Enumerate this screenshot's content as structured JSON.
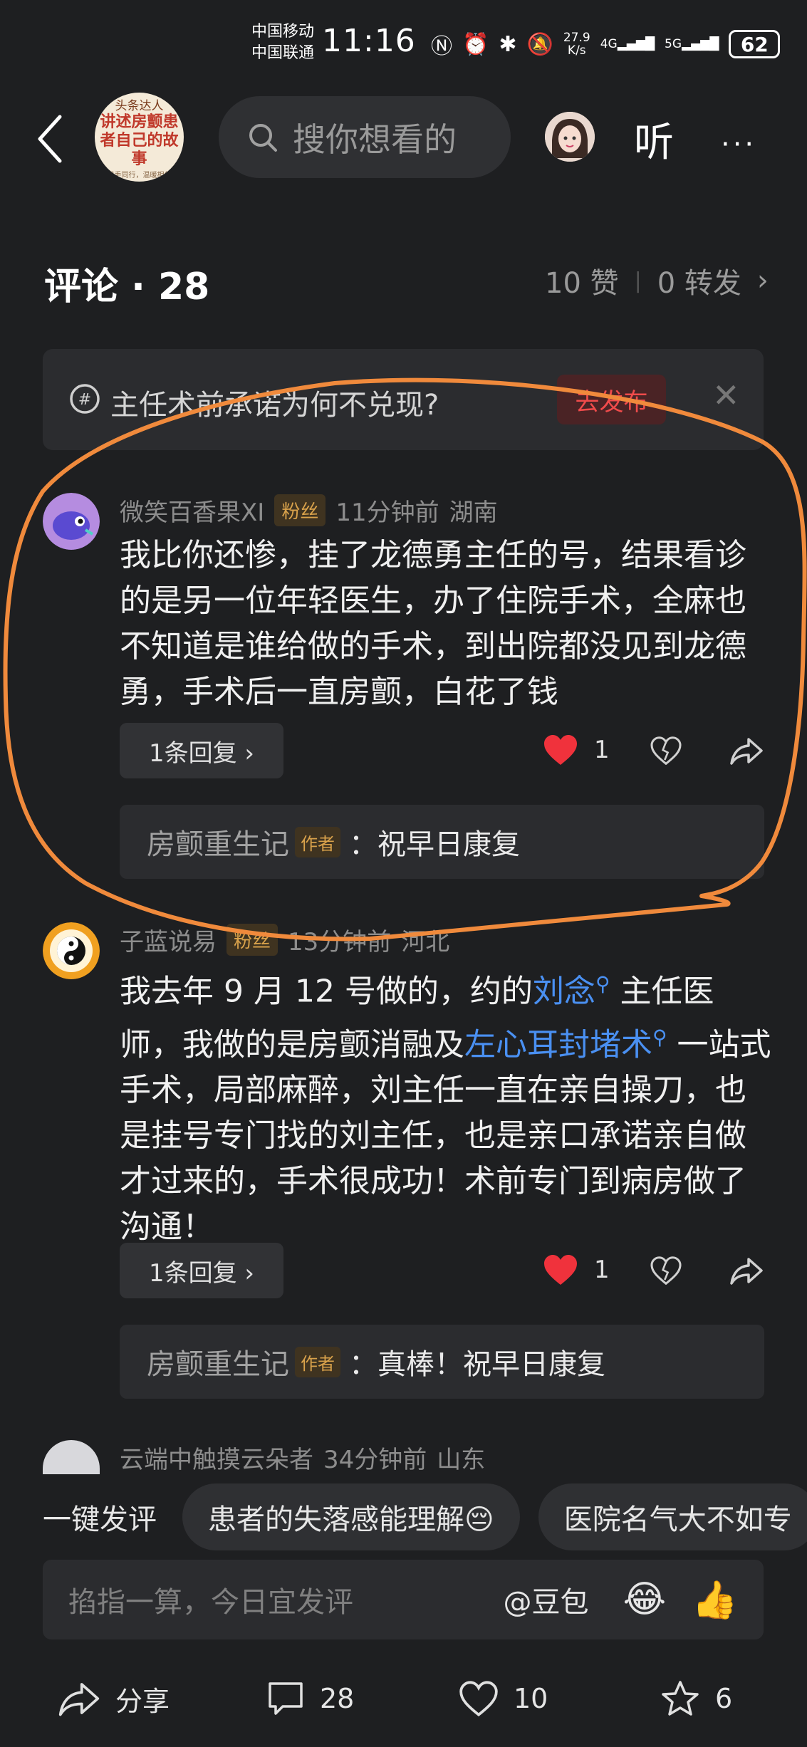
{
  "status_bar": {
    "carrier_1": "中国移动",
    "carrier_2": "中国联通",
    "time": "11:16",
    "net_speed_value": "27.9",
    "net_speed_unit": "K/s",
    "network_1": "4G",
    "network_2": "5G",
    "battery": "62"
  },
  "nav": {
    "cover_line1": "头条达人",
    "cover_line2": "讲述房颤患者自己的故事",
    "cover_line3": "携手同行，温暖相伴",
    "search_placeholder": "搜你想看的",
    "listen_label": "听",
    "more_label": "···"
  },
  "header": {
    "title": "评论 · 28",
    "likes": "10 赞",
    "separator": "|",
    "reposts": "0 转发",
    "arrow": "›"
  },
  "prompt": {
    "text": "主任术前承诺为何不兑现?",
    "button": "去发布",
    "close": "✕"
  },
  "comments": [
    {
      "username": "微笑百香果XI",
      "badge": "粉丝",
      "time": "11分钟前",
      "location": "湖南",
      "text": "我比你还惨，挂了龙德勇主任的号，结果看诊的是另一位年轻医生，办了住院手术，全麻也不知道是谁给做的手术，到出院都没见到龙德勇，手术后一直房颤，白花了钱",
      "reply_count": "1条回复 ›",
      "likes": "1",
      "author_reply_name": "房颤重生记",
      "author_badge": "作者",
      "author_reply_text": "：祝早日康复"
    },
    {
      "username": "子蓝说易",
      "badge": "粉丝",
      "time": "13分钟前",
      "location": "河北",
      "text_a": "我去年 9 月 12 号做的，约的",
      "link_1": "刘念",
      "text_b": " 主任医师，我做的是房颤消融及",
      "link_2": "左心耳封堵术",
      "text_c": " 一站式手术，局部麻醉，刘主任一直在亲自操刀，也是挂号专门找的刘主任，也是亲口承诺亲自做才过来的，手术很成功！术前专门到病房做了沟通！",
      "reply_count": "1条回复 ›",
      "likes": "1",
      "author_reply_name": "房颤重生记",
      "author_badge": "作者",
      "author_reply_text": "：真棒！祝早日康复"
    },
    {
      "username": "云端中触摸云朵者",
      "time": "34分钟前",
      "location": "山东"
    }
  ],
  "quick_reply": {
    "label": "一键发评",
    "chips": [
      "患者的失落感能理解😔",
      "医院名气大不如专"
    ]
  },
  "composer": {
    "placeholder": "掐指一算，今日宜发评",
    "doubao": "@豆包",
    "emoji_1": "😂",
    "emoji_2": "👍"
  },
  "bottom_bar": {
    "share": "分享",
    "comments": "28",
    "likes": "10",
    "favorites": "6"
  },
  "colors": {
    "background": "#1e1f21",
    "link": "#4a90f2",
    "like_red": "#f0323c",
    "badge_gold": "#d9a24b",
    "annotation_orange": "#f08a3c"
  }
}
